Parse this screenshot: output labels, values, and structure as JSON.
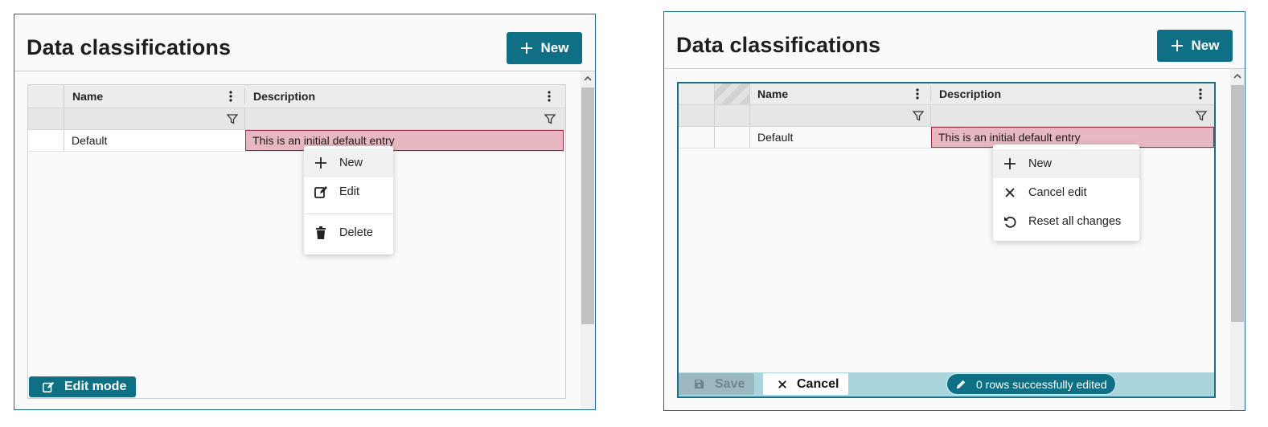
{
  "left_panel": {
    "title": "Data classifications",
    "new_button": "New",
    "columns": [
      "Name",
      "Description"
    ],
    "rows": [
      {
        "name": "Default",
        "description": "This is an initial default entry"
      }
    ],
    "context_menu": [
      "New",
      "Edit",
      "Delete"
    ],
    "edit_mode_button": "Edit mode"
  },
  "right_panel": {
    "title": "Data classifications",
    "new_button": "New",
    "columns": [
      "Name",
      "Description"
    ],
    "rows": [
      {
        "name": "Default",
        "description": "This is an initial default entry"
      }
    ],
    "context_menu": [
      "New",
      "Cancel edit",
      "Reset all changes"
    ],
    "save_button": "Save",
    "cancel_button": "Cancel",
    "status_badge": "0 rows successfully edited"
  },
  "colors": {
    "accent": "#0e6f85",
    "selected_cell": "#e8b8c2",
    "selected_border": "#9b2c43",
    "edit_footer": "#a9d5de"
  },
  "icons": [
    "plus-icon",
    "kebab-icon",
    "filter-icon",
    "edit-icon",
    "trash-icon",
    "close-icon",
    "undo-icon",
    "save-icon",
    "pencil-icon",
    "chevron-up-icon"
  ]
}
